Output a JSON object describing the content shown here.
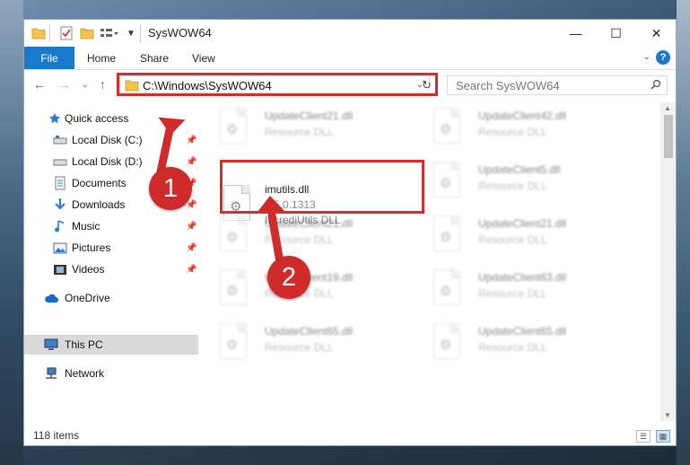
{
  "window": {
    "title": "SysWOW64",
    "controls": {
      "minimize": "—",
      "maximize": "☐",
      "close": "✕"
    }
  },
  "ribbon": {
    "tabs": [
      "File",
      "Home",
      "Share",
      "View"
    ],
    "help": "?"
  },
  "navigation": {
    "address_path": "C:\\Windows\\SysWOW64",
    "search_placeholder": "Search SysWOW64"
  },
  "sidebar": {
    "items": [
      {
        "label": "Quick access",
        "icon": "star-icon",
        "pinned": false
      },
      {
        "label": "Local Disk (C:)",
        "icon": "drive-icon",
        "pinned": true
      },
      {
        "label": "Local Disk (D:)",
        "icon": "drive-icon",
        "pinned": true
      },
      {
        "label": "Documents",
        "icon": "documents-icon",
        "pinned": true
      },
      {
        "label": "Downloads",
        "icon": "downloads-icon",
        "pinned": true
      },
      {
        "label": "Music",
        "icon": "music-icon",
        "pinned": true
      },
      {
        "label": "Pictures",
        "icon": "pictures-icon",
        "pinned": true
      },
      {
        "label": "Videos",
        "icon": "videos-icon",
        "pinned": true
      },
      {
        "label": "OneDrive",
        "icon": "cloud-icon",
        "pinned": false
      },
      {
        "label": "This PC",
        "icon": "computer-icon",
        "pinned": false,
        "selected": true
      },
      {
        "label": "Network",
        "icon": "network-icon",
        "pinned": false
      }
    ]
  },
  "files": [
    {
      "name": "UpdateClient21.dll",
      "desc": "Resource DLL",
      "blurred": true
    },
    {
      "name": "UpdateClient42.dll",
      "desc": "Resource DLL",
      "blurred": true
    },
    {
      "name": "imutils.dll",
      "version": "2.5.0.1313",
      "desc": "IncrediUtils DLL",
      "blurred": false,
      "highlighted": true
    },
    {
      "name": "UpdateClient5.dll",
      "desc": "Resource DLL",
      "blurred": true
    },
    {
      "name": "UpdateClient21.dll",
      "desc": "Resource DLL",
      "blurred": true
    },
    {
      "name": "UpdateClient21.dll",
      "desc": "Resource DLL",
      "blurred": true
    },
    {
      "name": "UpdateClient19.dll",
      "desc": "Resource DLL",
      "blurred": true
    },
    {
      "name": "UpdateClient63.dll",
      "desc": "Resource DLL",
      "blurred": true
    },
    {
      "name": "UpdateClient65.dll",
      "desc": "Resource DLL",
      "blurred": true
    },
    {
      "name": "UpdateClient65.dll",
      "desc": "Resource DLL",
      "blurred": true
    }
  ],
  "status": {
    "item_count": "118 items"
  },
  "annotations": {
    "step1": "1",
    "step2": "2",
    "color": "#cf2b2b"
  }
}
